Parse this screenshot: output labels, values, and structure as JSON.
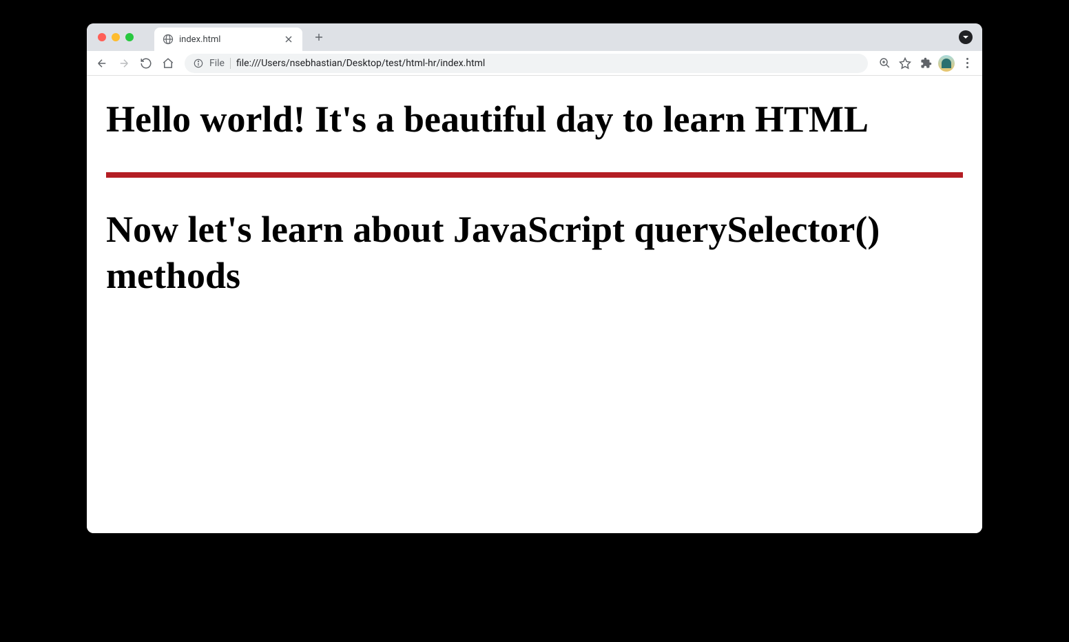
{
  "tab": {
    "title": "index.html"
  },
  "url": {
    "scheme": "File",
    "path": "file:///Users/nsebhastian/Desktop/test/html-hr/index.html"
  },
  "page": {
    "heading1": "Hello world! It's a beautiful day to learn HTML",
    "heading2": "Now let's learn about JavaScript querySelector() methods"
  }
}
